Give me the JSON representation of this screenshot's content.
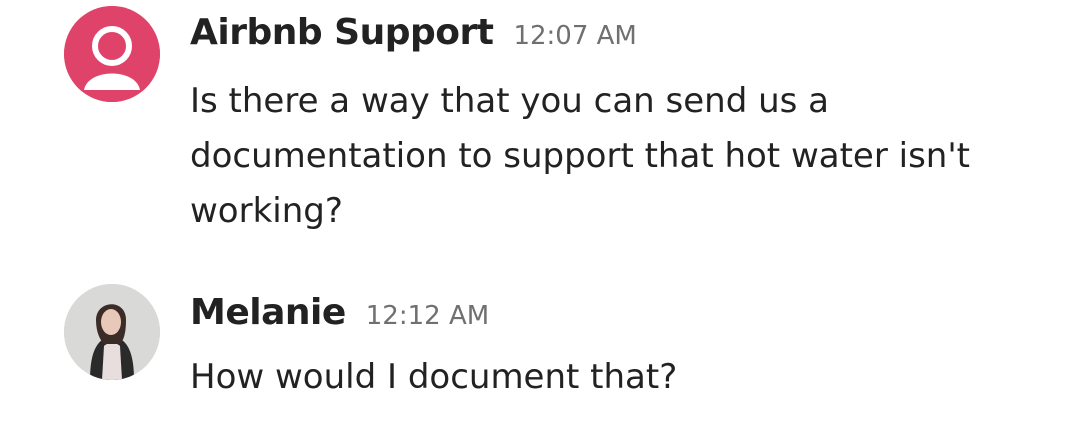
{
  "messages": [
    {
      "sender": "Airbnb Support",
      "time": "12:07 AM",
      "text": "Is there a way that you can send us a documentation to support that hot water isn't working?",
      "avatar": "default-user-icon",
      "avatar_color": "#e0436a"
    },
    {
      "sender": "Melanie",
      "time": "12:12 AM",
      "text": "How would I document that?",
      "avatar": "user-photo"
    }
  ]
}
